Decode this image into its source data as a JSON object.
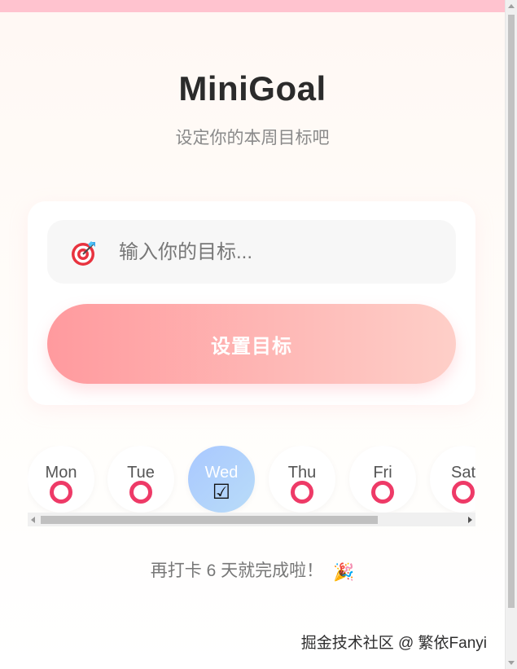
{
  "app": {
    "title": "MiniGoal",
    "subtitle": "设定你的本周目标吧"
  },
  "goal_form": {
    "input_value": "",
    "input_placeholder": "输入你的目标...",
    "input_icon": "target-icon",
    "submit_label": "设置目标",
    "button_gradient": [
      "#ff9a9e",
      "#fecfc8"
    ]
  },
  "days": [
    {
      "label": "Mon",
      "status": "pending",
      "mark_icon": "ring-icon"
    },
    {
      "label": "Tue",
      "status": "pending",
      "mark_icon": "ring-icon"
    },
    {
      "label": "Wed",
      "status": "done",
      "mark_icon": "checkbox-icon",
      "mark_glyph": "☑"
    },
    {
      "label": "Thu",
      "status": "pending",
      "mark_icon": "ring-icon"
    },
    {
      "label": "Fri",
      "status": "pending",
      "mark_icon": "ring-icon"
    },
    {
      "label": "Sat",
      "status": "pending",
      "mark_icon": "ring-icon"
    }
  ],
  "progress": {
    "message": "再打卡 6 天就完成啦！",
    "icon": "party-popper-icon",
    "icon_glyph": "🎉"
  },
  "watermark": "掘金技术社区 @ 繁依Fanyi",
  "colors": {
    "ring": "#ee3a67",
    "active_day_gradient": [
      "#a9c8ff",
      "#b9dcf8"
    ],
    "top_bar": "#ffc3cf"
  }
}
